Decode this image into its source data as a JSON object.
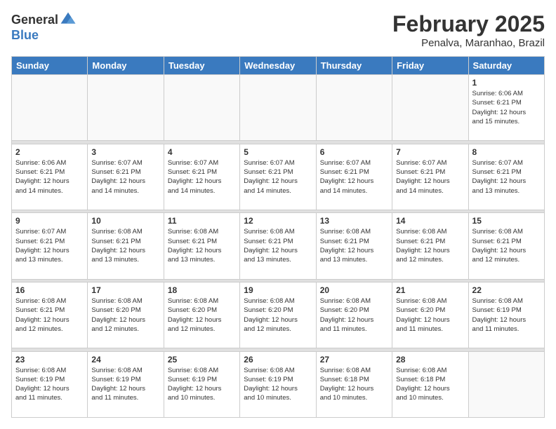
{
  "logo": {
    "general": "General",
    "blue": "Blue"
  },
  "title": "February 2025",
  "location": "Penalva, Maranhao, Brazil",
  "days_of_week": [
    "Sunday",
    "Monday",
    "Tuesday",
    "Wednesday",
    "Thursday",
    "Friday",
    "Saturday"
  ],
  "weeks": [
    [
      {
        "day": "",
        "info": ""
      },
      {
        "day": "",
        "info": ""
      },
      {
        "day": "",
        "info": ""
      },
      {
        "day": "",
        "info": ""
      },
      {
        "day": "",
        "info": ""
      },
      {
        "day": "",
        "info": ""
      },
      {
        "day": "1",
        "info": "Sunrise: 6:06 AM\nSunset: 6:21 PM\nDaylight: 12 hours\nand 15 minutes."
      }
    ],
    [
      {
        "day": "2",
        "info": "Sunrise: 6:06 AM\nSunset: 6:21 PM\nDaylight: 12 hours\nand 14 minutes."
      },
      {
        "day": "3",
        "info": "Sunrise: 6:07 AM\nSunset: 6:21 PM\nDaylight: 12 hours\nand 14 minutes."
      },
      {
        "day": "4",
        "info": "Sunrise: 6:07 AM\nSunset: 6:21 PM\nDaylight: 12 hours\nand 14 minutes."
      },
      {
        "day": "5",
        "info": "Sunrise: 6:07 AM\nSunset: 6:21 PM\nDaylight: 12 hours\nand 14 minutes."
      },
      {
        "day": "6",
        "info": "Sunrise: 6:07 AM\nSunset: 6:21 PM\nDaylight: 12 hours\nand 14 minutes."
      },
      {
        "day": "7",
        "info": "Sunrise: 6:07 AM\nSunset: 6:21 PM\nDaylight: 12 hours\nand 14 minutes."
      },
      {
        "day": "8",
        "info": "Sunrise: 6:07 AM\nSunset: 6:21 PM\nDaylight: 12 hours\nand 13 minutes."
      }
    ],
    [
      {
        "day": "9",
        "info": "Sunrise: 6:07 AM\nSunset: 6:21 PM\nDaylight: 12 hours\nand 13 minutes."
      },
      {
        "day": "10",
        "info": "Sunrise: 6:08 AM\nSunset: 6:21 PM\nDaylight: 12 hours\nand 13 minutes."
      },
      {
        "day": "11",
        "info": "Sunrise: 6:08 AM\nSunset: 6:21 PM\nDaylight: 12 hours\nand 13 minutes."
      },
      {
        "day": "12",
        "info": "Sunrise: 6:08 AM\nSunset: 6:21 PM\nDaylight: 12 hours\nand 13 minutes."
      },
      {
        "day": "13",
        "info": "Sunrise: 6:08 AM\nSunset: 6:21 PM\nDaylight: 12 hours\nand 13 minutes."
      },
      {
        "day": "14",
        "info": "Sunrise: 6:08 AM\nSunset: 6:21 PM\nDaylight: 12 hours\nand 12 minutes."
      },
      {
        "day": "15",
        "info": "Sunrise: 6:08 AM\nSunset: 6:21 PM\nDaylight: 12 hours\nand 12 minutes."
      }
    ],
    [
      {
        "day": "16",
        "info": "Sunrise: 6:08 AM\nSunset: 6:21 PM\nDaylight: 12 hours\nand 12 minutes."
      },
      {
        "day": "17",
        "info": "Sunrise: 6:08 AM\nSunset: 6:20 PM\nDaylight: 12 hours\nand 12 minutes."
      },
      {
        "day": "18",
        "info": "Sunrise: 6:08 AM\nSunset: 6:20 PM\nDaylight: 12 hours\nand 12 minutes."
      },
      {
        "day": "19",
        "info": "Sunrise: 6:08 AM\nSunset: 6:20 PM\nDaylight: 12 hours\nand 12 minutes."
      },
      {
        "day": "20",
        "info": "Sunrise: 6:08 AM\nSunset: 6:20 PM\nDaylight: 12 hours\nand 11 minutes."
      },
      {
        "day": "21",
        "info": "Sunrise: 6:08 AM\nSunset: 6:20 PM\nDaylight: 12 hours\nand 11 minutes."
      },
      {
        "day": "22",
        "info": "Sunrise: 6:08 AM\nSunset: 6:19 PM\nDaylight: 12 hours\nand 11 minutes."
      }
    ],
    [
      {
        "day": "23",
        "info": "Sunrise: 6:08 AM\nSunset: 6:19 PM\nDaylight: 12 hours\nand 11 minutes."
      },
      {
        "day": "24",
        "info": "Sunrise: 6:08 AM\nSunset: 6:19 PM\nDaylight: 12 hours\nand 11 minutes."
      },
      {
        "day": "25",
        "info": "Sunrise: 6:08 AM\nSunset: 6:19 PM\nDaylight: 12 hours\nand 10 minutes."
      },
      {
        "day": "26",
        "info": "Sunrise: 6:08 AM\nSunset: 6:19 PM\nDaylight: 12 hours\nand 10 minutes."
      },
      {
        "day": "27",
        "info": "Sunrise: 6:08 AM\nSunset: 6:18 PM\nDaylight: 12 hours\nand 10 minutes."
      },
      {
        "day": "28",
        "info": "Sunrise: 6:08 AM\nSunset: 6:18 PM\nDaylight: 12 hours\nand 10 minutes."
      },
      {
        "day": "",
        "info": ""
      }
    ]
  ]
}
